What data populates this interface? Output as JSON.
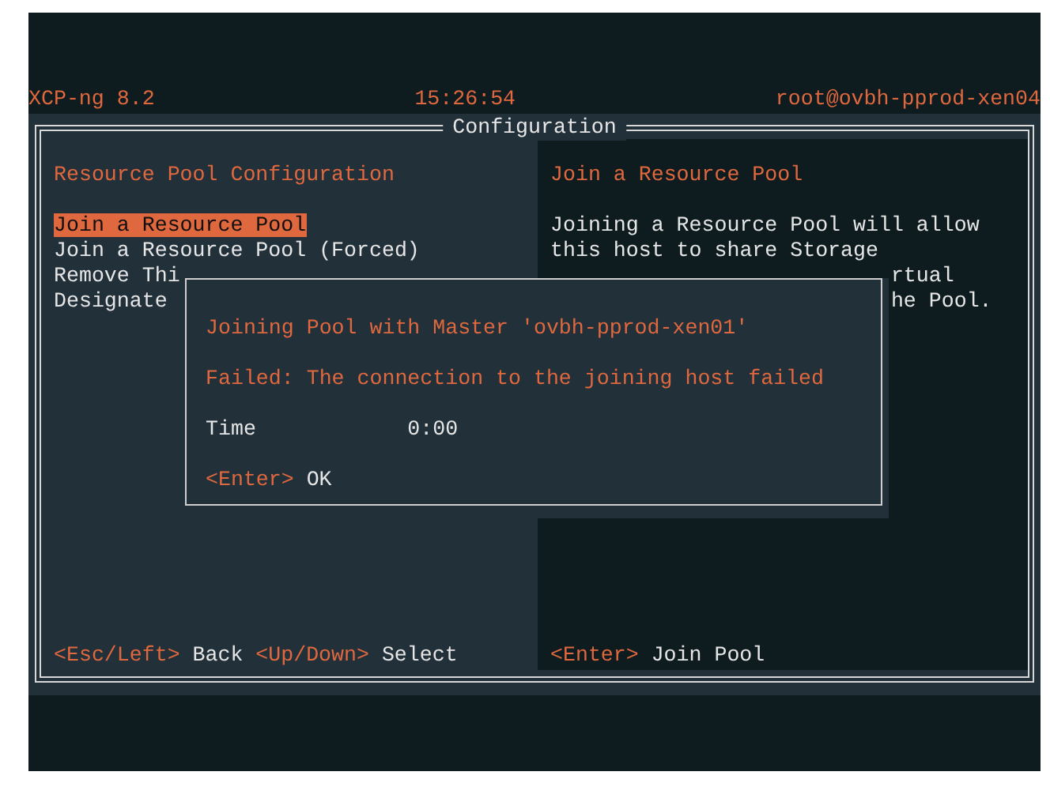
{
  "header": {
    "product": "XCP-ng 8.2",
    "clock": "15:26:54",
    "host": "root@ovbh-pprod-xen04"
  },
  "window": {
    "title": "Configuration"
  },
  "left_pane": {
    "title": "Resource Pool Configuration",
    "items": [
      {
        "label": "Join a Resource Pool",
        "selected": true
      },
      {
        "label": "Join a Resource Pool (Forced)",
        "selected": false
      },
      {
        "label": "Remove Thi",
        "selected": false
      },
      {
        "label": "Designate",
        "selected": false
      }
    ],
    "hints": [
      {
        "key": "<Esc/Left>",
        "action": "Back"
      },
      {
        "key": "<Up/Down>",
        "action": "Select"
      }
    ]
  },
  "right_pane": {
    "title": "Join a Resource Pool",
    "lines": [
      {
        "text": "Joining a Resource Pool will allow",
        "kind": "full"
      },
      {
        "text": "this host to share Storage",
        "kind": "full"
      },
      {
        "text": "rtual",
        "kind": "occluded"
      },
      {
        "text": "he Pool.",
        "kind": "occluded"
      }
    ],
    "hints": [
      {
        "key": "<Enter>",
        "action": "Join Pool"
      }
    ]
  },
  "dialog": {
    "heading": "Joining Pool with Master 'ovbh-pprod-xen01'",
    "error": "Failed: The connection to the joining host failed",
    "fields": [
      {
        "label": "Time",
        "value": "0:00"
      }
    ],
    "hints": [
      {
        "key": "<Enter>",
        "action": "OK"
      }
    ]
  }
}
